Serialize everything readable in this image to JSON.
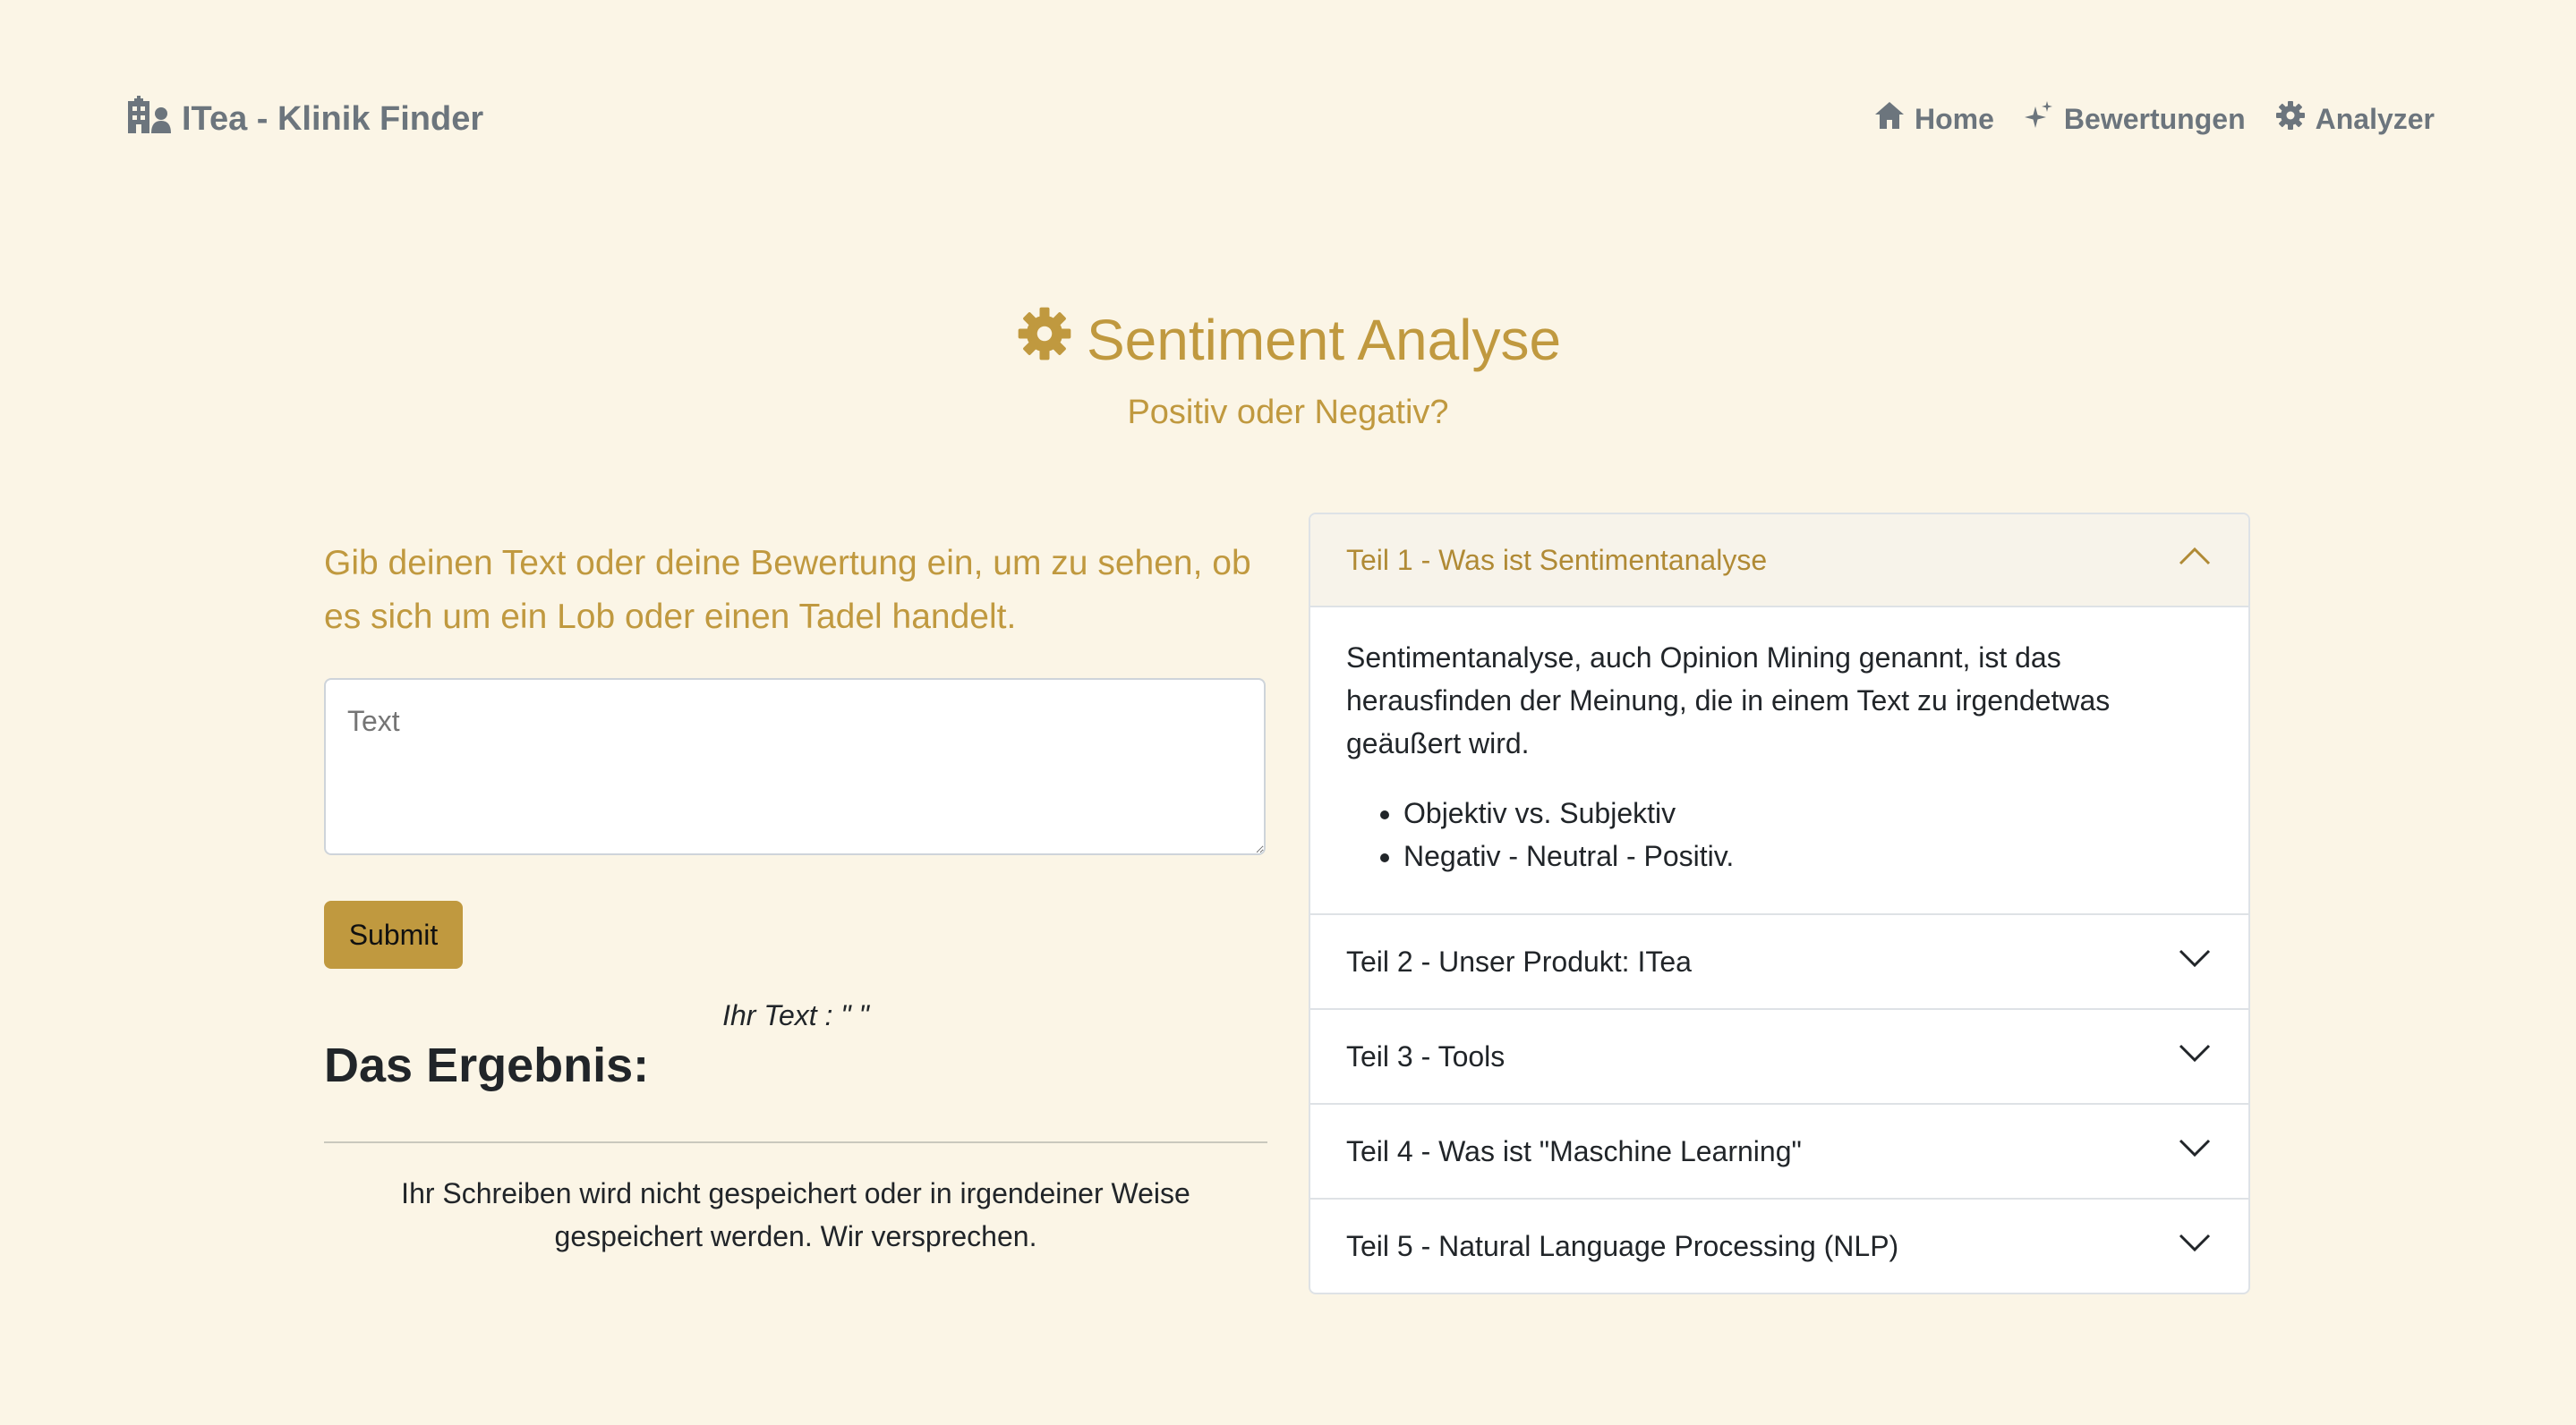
{
  "navbar": {
    "brand": "ITea - Klinik Finder",
    "links": [
      {
        "label": "Home",
        "icon": "house-icon"
      },
      {
        "label": "Bewertungen",
        "icon": "sparkles-icon"
      },
      {
        "label": "Analyzer",
        "icon": "gear-icon"
      }
    ]
  },
  "hero": {
    "title": "Sentiment Analyse",
    "subtitle": "Positiv oder Negativ?"
  },
  "form": {
    "lead": "Gib deinen Text oder deine Bewertung ein, um zu sehen, ob es sich um ein Lob oder einen Tadel handelt.",
    "textarea_placeholder": "Text",
    "submit_label": "Submit",
    "your_text": "Ihr Text : \" \"",
    "result_title": "Das Ergebnis:",
    "note": "Ihr Schreiben wird nicht gespeichert oder in irgendeiner Weise gespeichert werden. Wir versprechen."
  },
  "accordion": {
    "items": [
      {
        "title": "Teil 1 - Was ist Sentimentanalyse",
        "expanded": true
      },
      {
        "title": "Teil 2 - Unser Produkt: ITea",
        "expanded": false
      },
      {
        "title": "Teil 3 - Tools",
        "expanded": false
      },
      {
        "title": "Teil 4 - Was ist \"Maschine Learning\"",
        "expanded": false
      },
      {
        "title": "Teil 5 - Natural Language Processing (NLP)",
        "expanded": false
      }
    ],
    "body": {
      "paragraph": "Sentimentanalyse, auch Opinion Mining genannt, ist das herausfinden der Meinung, die in einem Text zu irgendetwas geäußert wird.",
      "bullets": [
        "Objektiv vs. Subjektiv",
        "Negativ - Neutral - Positiv."
      ]
    }
  },
  "colors": {
    "background": "#fbf5e6",
    "accent": "#c0993f",
    "nav_text": "#6c757d"
  }
}
